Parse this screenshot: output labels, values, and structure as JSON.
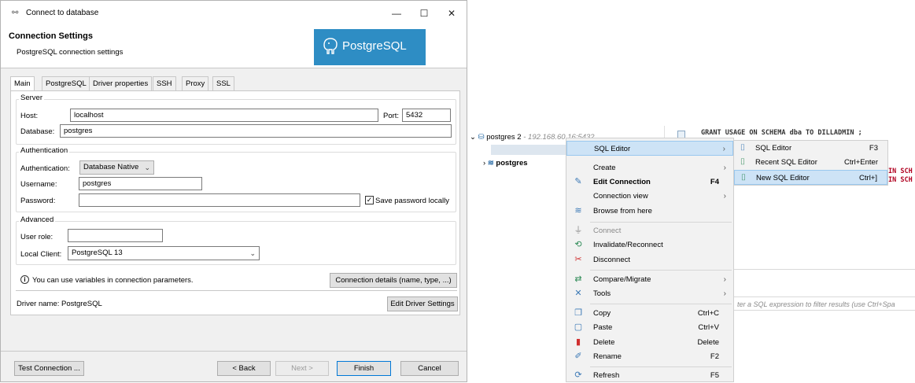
{
  "dialog": {
    "title": "Connect to database",
    "header_title": "Connection Settings",
    "header_subtitle": "PostgreSQL connection settings",
    "logo_text": "PostgreSQL",
    "tabs": [
      {
        "label": "Main"
      },
      {
        "label": "PostgreSQL"
      },
      {
        "label": "Driver properties"
      },
      {
        "label": "SSH"
      },
      {
        "label": "Proxy"
      },
      {
        "label": "SSL"
      }
    ],
    "server": {
      "group_label": "Server",
      "host_label": "Host:",
      "host_value": "localhost",
      "port_label": "Port:",
      "port_value": "5432",
      "database_label": "Database:",
      "database_value": "postgres"
    },
    "auth": {
      "group_label": "Authentication",
      "auth_label": "Authentication:",
      "auth_value": "Database Native",
      "username_label": "Username:",
      "username_value": "postgres",
      "password_label": "Password:",
      "password_value": "",
      "save_password_label": "Save password locally",
      "save_password_checked": true
    },
    "advanced": {
      "group_label": "Advanced",
      "user_role_label": "User role:",
      "user_role_value": "",
      "local_client_label": "Local Client:",
      "local_client_value": "PostgreSQL 13"
    },
    "info_text": "You can use variables in connection parameters.",
    "connection_details_button": "Connection details (name, type, ...)",
    "driver_name_text": "Driver name:  PostgreSQL",
    "edit_driver_button": "Edit Driver Settings",
    "buttons": {
      "test": "Test Connection ...",
      "back": "< Back",
      "next": "Next >",
      "finish": "Finish",
      "cancel": "Cancel"
    }
  },
  "navigator": {
    "connection_label": "postgres 2",
    "connection_host": "- 192.168.60.16:5432",
    "db_label": "postgres"
  },
  "editor": {
    "line1": "GRANT USAGE ON SCHEMA dba TO  DILLADMIN ;",
    "line2": "IN SCH",
    "line3": "IN SCH",
    "filter_placeholder": "ter a SQL expression to filter results (use Ctrl+Spa"
  },
  "context_menu": {
    "items": [
      {
        "label": "SQL Editor",
        "shortcut": "",
        "submenu": true,
        "icon": "none"
      },
      {
        "label": "Create",
        "shortcut": "",
        "submenu": true,
        "icon": "none"
      },
      {
        "label": "Edit Connection",
        "shortcut": "F4",
        "submenu": false,
        "icon": "pencil-icon"
      },
      {
        "label": "Connection view",
        "shortcut": "",
        "submenu": true,
        "icon": "none"
      },
      {
        "label": "Browse from here",
        "shortcut": "",
        "submenu": false,
        "icon": "database-icon"
      },
      {
        "label": "Connect",
        "shortcut": "",
        "submenu": false,
        "icon": "plug-icon"
      },
      {
        "label": "Invalidate/Reconnect",
        "shortcut": "",
        "submenu": false,
        "icon": "reconnect-icon"
      },
      {
        "label": "Disconnect",
        "shortcut": "",
        "submenu": false,
        "icon": "disconnect-icon"
      },
      {
        "label": "Compare/Migrate",
        "shortcut": "",
        "submenu": true,
        "icon": "compare-icon"
      },
      {
        "label": "Tools",
        "shortcut": "",
        "submenu": true,
        "icon": "tools-icon"
      },
      {
        "label": "Copy",
        "shortcut": "Ctrl+C",
        "submenu": false,
        "icon": "copy-icon"
      },
      {
        "label": "Paste",
        "shortcut": "Ctrl+V",
        "submenu": false,
        "icon": "paste-icon"
      },
      {
        "label": "Delete",
        "shortcut": "Delete",
        "submenu": false,
        "icon": "delete-icon"
      },
      {
        "label": "Rename",
        "shortcut": "F2",
        "submenu": false,
        "icon": "rename-icon"
      },
      {
        "label": "Refresh",
        "shortcut": "F5",
        "submenu": false,
        "icon": "refresh-icon"
      }
    ]
  },
  "submenu": {
    "items": [
      {
        "label": "SQL Editor",
        "shortcut": "F3",
        "icon": "sql-editor-icon"
      },
      {
        "label": "Recent SQL Editor",
        "shortcut": "Ctrl+Enter",
        "icon": "recent-sql-editor-icon"
      },
      {
        "label": "New SQL Editor",
        "shortcut": "Ctrl+]",
        "icon": "new-sql-editor-icon"
      }
    ]
  },
  "colors": {
    "postgres_blue": "#2e8dc4",
    "menu_highlight": "#cde3f6",
    "sql_keyword": "#b00020"
  }
}
